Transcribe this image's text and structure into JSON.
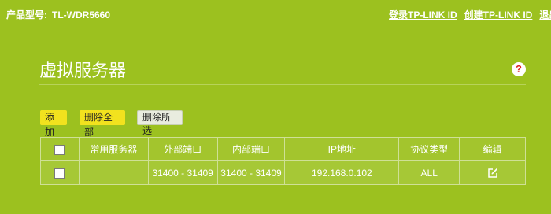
{
  "header": {
    "product_label": "产品型号:",
    "product_model": "TL-WDR5660",
    "login_link": "登录TP-LINK ID",
    "create_link": "创建TP-LINK ID",
    "exit_link": "退出"
  },
  "page": {
    "title": "虚拟服务器",
    "help_icon": "help-question-icon"
  },
  "toolbar": {
    "add_label": "添加",
    "delete_all_label": "删除全部",
    "delete_selected_label": "删除所选"
  },
  "table": {
    "columns": [
      "",
      "常用服务器",
      "外部端口",
      "内部端口",
      "IP地址",
      "协议类型",
      "编辑"
    ],
    "rows": [
      {
        "checked": false,
        "common_server": "",
        "external_port": "31400 - 31409",
        "internal_port": "31400 - 31409",
        "ip": "192.168.0.102",
        "protocol": "ALL",
        "edit_icon": "edit-icon"
      }
    ]
  },
  "colors": {
    "background": "#9cc11f",
    "button_yellow": "#f2e21e",
    "help_icon_red": "#dd2222"
  }
}
